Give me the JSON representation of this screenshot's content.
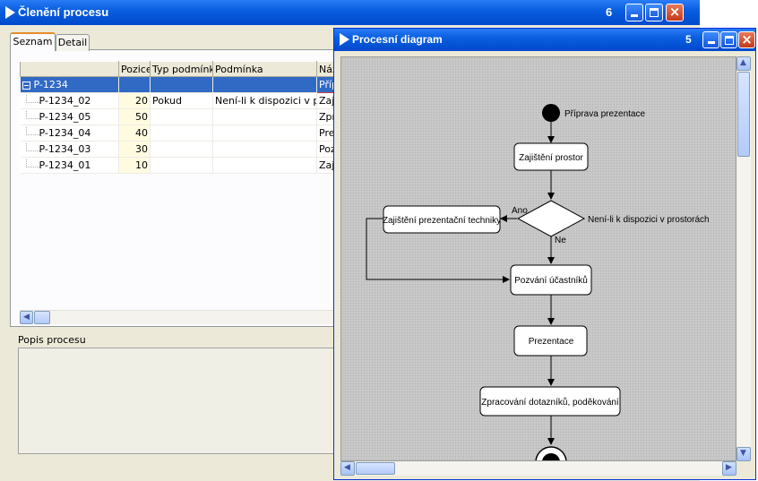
{
  "win1": {
    "title": "Členění procesu",
    "number": "6",
    "tabs": [
      "Seznam",
      "Detail"
    ],
    "columns": [
      "",
      "Pozice",
      "Typ podmínky",
      "Podmínka",
      "Náz"
    ],
    "rows": [
      {
        "name": "P-1234",
        "pozice": "",
        "typ": "",
        "podminka": "",
        "nazev": "Přípr"
      },
      {
        "name": "P-1234_02",
        "pozice": "20",
        "typ": "Pokud",
        "podminka": "Není-li k dispozici v prost",
        "nazev": "Zajiš"
      },
      {
        "name": "P-1234_05",
        "pozice": "50",
        "typ": "",
        "podminka": "",
        "nazev": "Zpra"
      },
      {
        "name": "P-1234_04",
        "pozice": "40",
        "typ": "",
        "podminka": "",
        "nazev": "Prez"
      },
      {
        "name": "P-1234_03",
        "pozice": "30",
        "typ": "",
        "podminka": "",
        "nazev": "Pozv"
      },
      {
        "name": "P-1234_01",
        "pozice": "10",
        "typ": "",
        "podminka": "",
        "nazev": "Zajiš"
      }
    ],
    "popis_label": "Popis procesu"
  },
  "win2": {
    "title": "Procesní diagram",
    "number": "5",
    "diagram": {
      "start_label": "Příprava prezentace",
      "node1": "Zajištění prostor",
      "decision_yes": "Ano",
      "decision_no": "Ne",
      "decision_cond": "Není-li k dispozici v prostorách",
      "node_branch": "Zajištění prezentační techniky",
      "node2": "Pozvání účastníků",
      "node3": "Prezentace",
      "node4": "Zpracování dotazníků, poděkování"
    }
  }
}
